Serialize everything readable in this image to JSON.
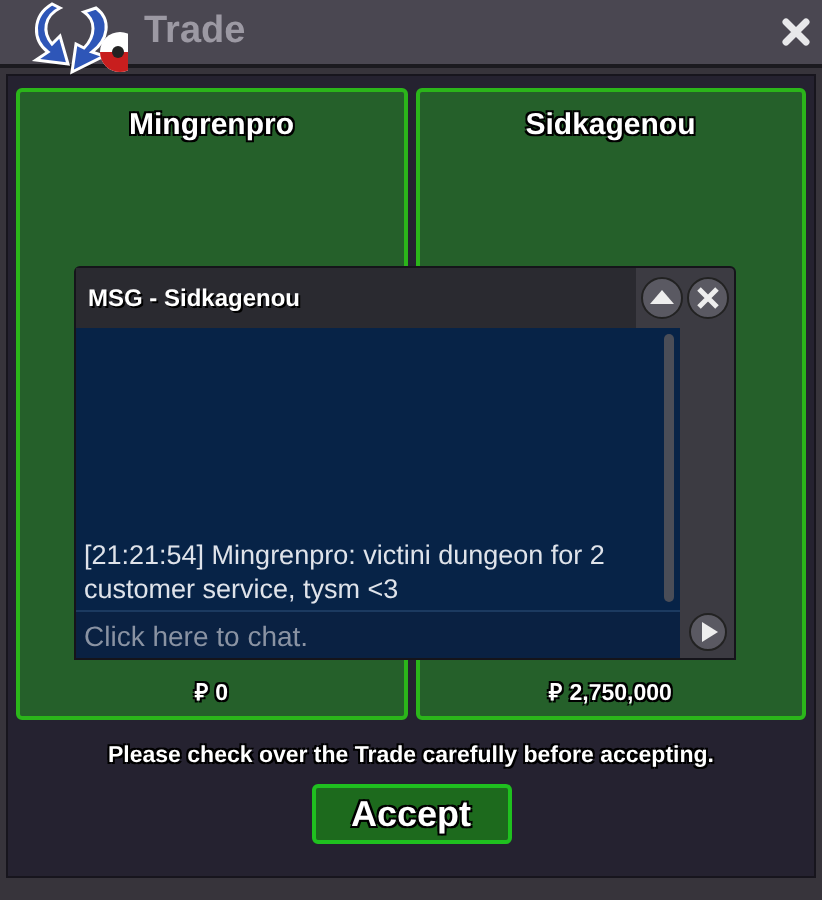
{
  "window": {
    "title": "Trade"
  },
  "traders": [
    {
      "name": "Mingrenpro",
      "money": "₽ 0"
    },
    {
      "name": "Sidkagenou",
      "money": "₽ 2,750,000"
    }
  ],
  "chat": {
    "title": "MSG - Sidkagenou",
    "messages": [
      "[21:21:54] Mingrenpro: victini dungeon for 2 customer service, tysm <3"
    ],
    "input": {
      "placeholder": "Click here to chat."
    }
  },
  "notice": "Please check over the Trade carefully before accepting.",
  "accept_button": "Accept"
}
